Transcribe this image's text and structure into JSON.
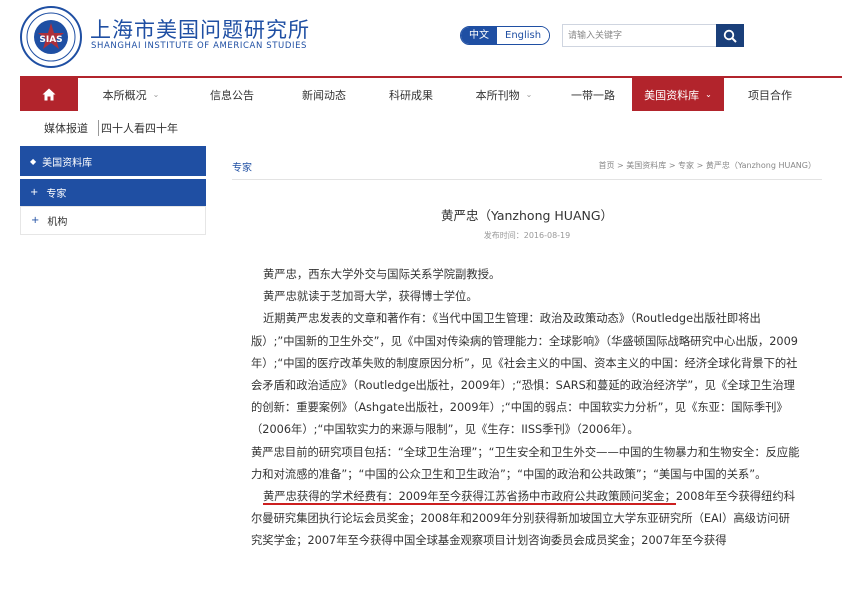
{
  "header": {
    "logo_seal_text": "SIAS",
    "logo_cn": "上海市美国问题研究所",
    "logo_en": "SHANGHAI INSTITUTE OF AMERICAN STUDIES",
    "lang_cn": "中文",
    "lang_en": "English",
    "search_placeholder": "请输入关键字"
  },
  "nav": {
    "home_icon": "home-icon",
    "items": [
      {
        "label": "本所概况",
        "chevron": "⌄"
      },
      {
        "label": "信息公告"
      },
      {
        "label": "新闻动态"
      },
      {
        "label": "科研成果"
      },
      {
        "label": "本所刊物",
        "chevron": "⌄"
      },
      {
        "label": "一带一路"
      },
      {
        "label": "美国资料库",
        "chevron": "⌄"
      },
      {
        "label": "项目合作"
      }
    ]
  },
  "subnav": {
    "items": [
      "媒体报道",
      "四十人看四十年"
    ]
  },
  "sidebar": {
    "title": "美国资料库",
    "items": [
      {
        "label": "专家"
      },
      {
        "label": "机构"
      }
    ]
  },
  "main": {
    "section_title": "专家",
    "breadcrumb": "首页 > 美国资料库 > 专家 > 黄严忠（Yanzhong HUANG）",
    "title": "黄严忠（Yanzhong HUANG）",
    "date": "发布时间：2016-08-19",
    "paragraphs": [
      "黄严忠，西东大学外交与国际关系学院副教授。",
      "黄严忠就读于芝加哥大学，获得博士学位。",
      "近期黄严忠发表的文章和著作有：《当代中国卫生管理：政治及政策动态》（Routledge出版社即将出版）;”中国新的卫生外交”，见《中国对传染病的管理能力：全球影响》（华盛顿国际战略研究中心出版，2009年）;“中国的医疗改革失败的制度原因分析”，见《社会主义的中国、资本主义的中国：经济全球化背景下的社会矛盾和政治适应》（Routledge出版社，2009年）;“恐惧：SARS和蔓延的政治经济学”，见《全球卫生治理的创新：重要案例》（Ashgate出版社，2009年）;“中国的弱点：中国软实力分析”，见《东亚：国际季刊》（2006年）;“中国软实力的来源与限制”，见《生存：IISS季刊》（2006年）。",
      "黄严忠目前的研究项目包括：“全球卫生治理”；“卫生安全和卫生外交——中国的生物暴力和生物安全：反应能力和对流感的准备”；“中国的公众卫生和卫生政治”；“中国的政治和公共政策”；“美国与中国的关系”。"
    ],
    "p5_highlight": "黄严忠获得的学术经费有：2009年至今获得江苏省扬中市政府公共政策顾问奖金；",
    "p5_rest": "2008年至今获得纽约科尔曼研究集团执行论坛会员奖金；2008年和2009年分别获得新加坡国立大学东亚研究所（EAI）高级访问研究奖学金；2007年至今获得中国全球基金观察项目计划咨询委员会成员奖金；2007年至今获得"
  },
  "colors": {
    "brand_blue": "#1f4fa3",
    "nav_red": "#b2242c",
    "highlight_red": "#cc1f1f"
  }
}
